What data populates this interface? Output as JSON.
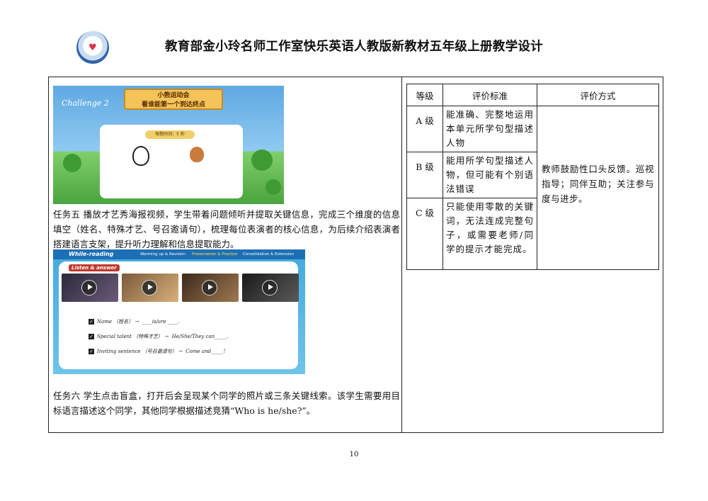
{
  "header": {
    "title": "教育部金小玲名师工作室快乐英语人教版新教材五年级上册教学设计"
  },
  "slide1": {
    "banner_line1": "小熊运动会",
    "banner_line2": "看谁能第一个到达终点",
    "challenge_label": "Challenge 2",
    "timer_text": "每题时间：5 秒"
  },
  "task5": {
    "text": "任务五 播放才艺秀海报视频，学生带着问题倾听并提取关键信息，完成三个维度的信息填空（姓名、特殊才艺、号召邀请句），梳理每位表演者的核心信息，为后续介绍表演者搭建语言支架，提升听力理解和信息提取能力。"
  },
  "slide2": {
    "nav_title": "While-reading",
    "nav_items": [
      "Warming up & Revision",
      "Presentation & Practice",
      "Consolidation & Extension"
    ],
    "section_label": "Listen & answer",
    "lines": [
      "Name （姓名） →  ____is/are ____.",
      "Special talent （特殊才艺） →  He/She/They can_____.",
      "Inviting sentence （号召邀请句） →  Come and_____!"
    ]
  },
  "task6": {
    "text": "任务六 学生点击盲盒，打开后会呈现某个同学的照片或三条关键线索。该学生需要用目标语言描述这个同学，其他同学根据描述竞猜“Who is he/she?”。"
  },
  "rubric": {
    "headers": [
      "等级",
      "评价标准",
      "评价方式"
    ],
    "rows": [
      {
        "level": "A 级",
        "criteria": "能准确、完整地运用本单元所学句型描述人物"
      },
      {
        "level": "B 级",
        "criteria": "能用所学句型描述人物，但可能有个别语法错误"
      },
      {
        "level": "C 级",
        "criteria": "只能使用零散的关键词，无法连成完整句子，或需要老师/同学的提示才能完成。"
      }
    ],
    "method": "教师鼓励性口头反馈。巡视指导；同伴互助；关注参与度与进步。"
  },
  "footer": {
    "page_number": "10"
  }
}
